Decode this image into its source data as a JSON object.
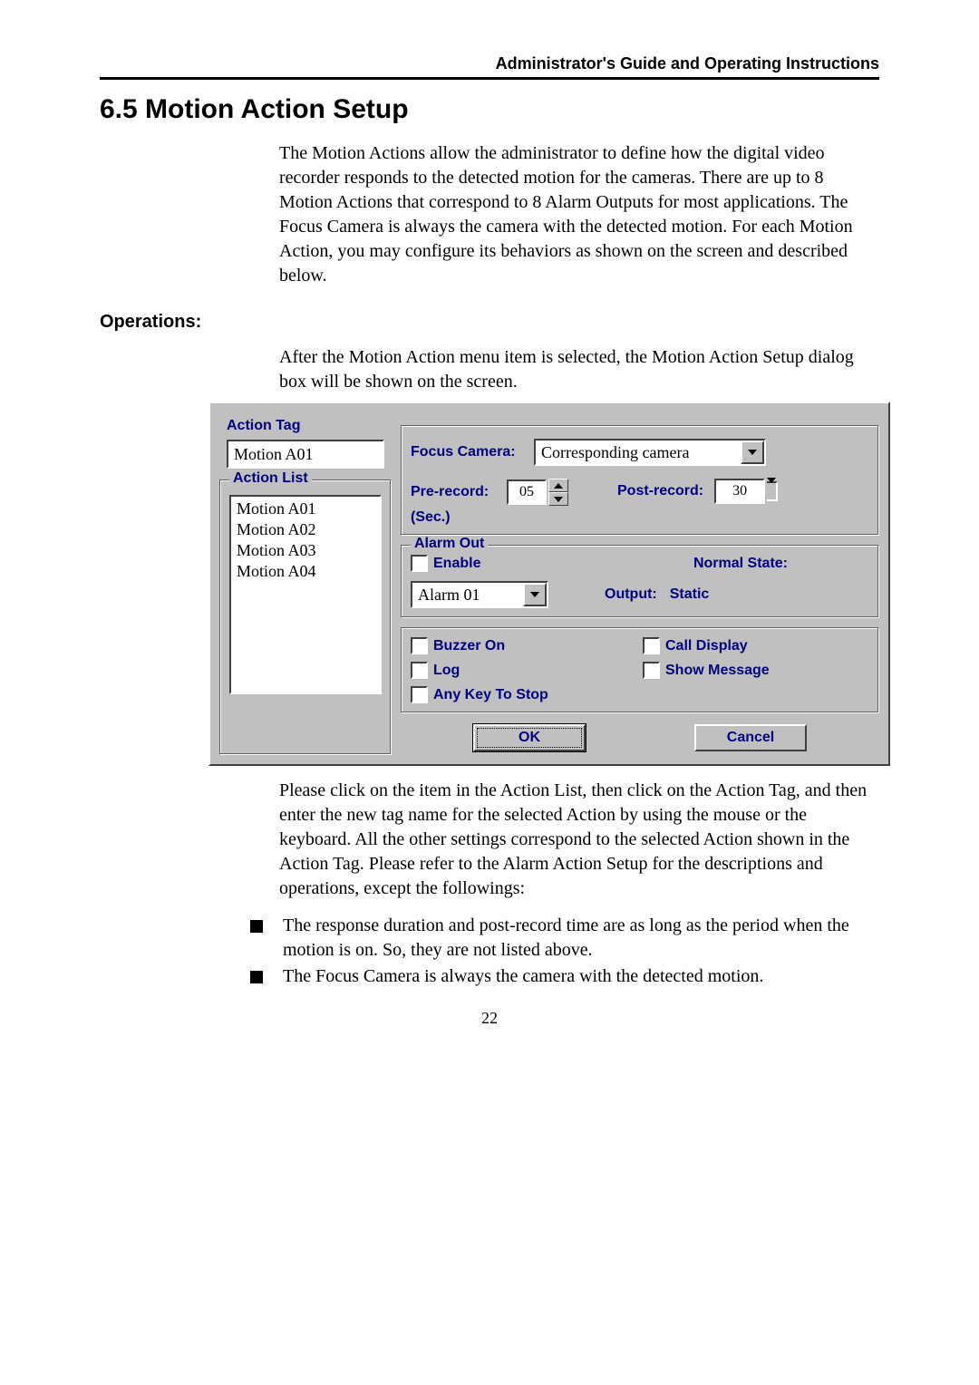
{
  "page_header": "Administrator's Guide and Operating Instructions",
  "section_title": "6.5 Motion Action Setup",
  "para_intro": "The Motion Actions allow the administrator to define how the digital video recorder responds to the detected motion for the cameras. There are up to 8 Motion Actions that correspond to 8 Alarm Outputs for most applications.    The Focus Camera is always the camera with the detected motion.    For each Motion Action, you may configure its behaviors as shown on the screen and described below.",
  "operations_heading": "Operations:",
  "para_operations": "After the Motion Action menu item is selected, the Motion Action Setup dialog box will be shown on the screen.",
  "dialog": {
    "action_tag_label": "Action Tag",
    "action_tag_value": "Motion A01",
    "action_list_label": "Action List",
    "action_list_items": [
      "Motion A01",
      "Motion A02",
      "Motion A03",
      "Motion A04"
    ],
    "focus_camera_label": "Focus Camera:",
    "focus_camera_value": "Corresponding camera",
    "pre_record_label": "Pre-record:",
    "pre_record_value": "05",
    "pre_record_unit": "(Sec.)",
    "post_record_label": "Post-record:",
    "post_record_value": "30",
    "alarm_out_label": "Alarm Out",
    "enable_label": "Enable",
    "normal_state_label": "Normal State:",
    "output_label": "Output:",
    "output_value": "Static",
    "alarm_dropdown_value": "Alarm 01",
    "buzzer_label": "Buzzer On",
    "log_label": "Log",
    "anykey_label": "Any Key To Stop",
    "call_display_label": "Call Display",
    "show_message_label": "Show Message",
    "ok_btn": "OK",
    "cancel_btn": "Cancel"
  },
  "para_after_dialog": "Please click on the item in the Action List, then click on the Action Tag, and then enter the new tag name for the selected Action by using the mouse or the keyboard.    All the other settings correspond to the selected Action shown in the Action Tag.    Please refer to the Alarm Action Setup for the descriptions and operations, except the followings:",
  "bullets": [
    "The response duration and post-record time are as long as the period when the motion is on.    So, they are not listed above.",
    "The Focus Camera is always the camera with the detected motion."
  ],
  "page_number": "22"
}
